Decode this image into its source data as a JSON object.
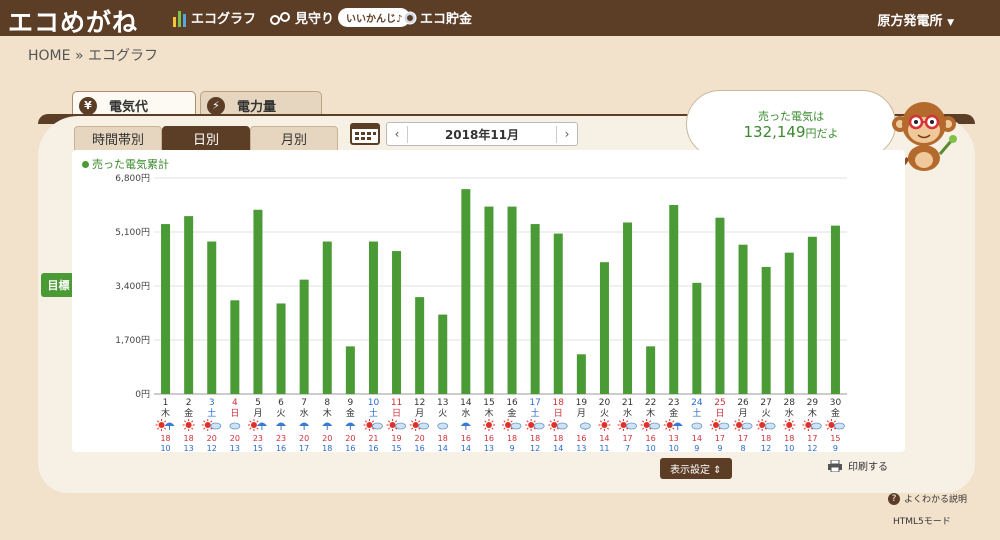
{
  "header": {
    "logo": "エコめがね",
    "nav": [
      {
        "label": "エコグラフ",
        "icon": "bar-graph-icon"
      },
      {
        "label": "見守り",
        "icon": "glasses-icon",
        "pill": "いいかんじ♪"
      },
      {
        "label": "エコ貯金",
        "icon": "coin-icon"
      }
    ],
    "plant": "原方発電所",
    "plant_arrow": "▼"
  },
  "breadcrumb": {
    "home": "HOME",
    "sep": "»",
    "current": "エコグラフ"
  },
  "outer_tabs": [
    {
      "label": "電気代",
      "icon": "yen-icon",
      "glyph": "¥",
      "active": true
    },
    {
      "label": "電力量",
      "icon": "lightning-icon",
      "glyph": "⚡",
      "active": false
    }
  ],
  "sub_tabs": [
    "時間帯別",
    "日別",
    "月別"
  ],
  "active_sub_tab": "日別",
  "date": {
    "label": "2018年11月",
    "prev": "‹",
    "next": "›"
  },
  "bubble": {
    "line1": "売った電気は",
    "amount": "132,149",
    "suffix": "円だよ"
  },
  "goal_button": "目標 ⇕",
  "display_settings": "表示設定 ⇕",
  "print": "印刷する",
  "help": "よくわかる説明",
  "html5": "HTML5モード",
  "colors": {
    "bar": "#4a9a35",
    "header": "#5c3d26",
    "saturday": "#2a6ad0",
    "sunday": "#d0303a",
    "accent": "#3a8a2c"
  },
  "chart_data": {
    "type": "bar",
    "legend": "売った電気累計",
    "y_ticks": [
      "0円",
      "1,700円",
      "3,400円",
      "5,100円",
      "6,800円"
    ],
    "ylim": [
      0,
      6800
    ],
    "days": [
      "1",
      "2",
      "3",
      "4",
      "5",
      "6",
      "7",
      "8",
      "9",
      "10",
      "11",
      "12",
      "13",
      "14",
      "15",
      "16",
      "17",
      "18",
      "19",
      "20",
      "21",
      "22",
      "23",
      "24",
      "25",
      "26",
      "27",
      "28",
      "29",
      "30"
    ],
    "weekdays": [
      "木",
      "金",
      "土",
      "日",
      "月",
      "火",
      "水",
      "木",
      "金",
      "土",
      "日",
      "月",
      "火",
      "水",
      "木",
      "金",
      "土",
      "日",
      "月",
      "火",
      "水",
      "木",
      "金",
      "土",
      "日",
      "月",
      "火",
      "水",
      "木",
      "金"
    ],
    "values": [
      5350,
      5600,
      4800,
      2950,
      5800,
      2850,
      3600,
      4800,
      1500,
      4800,
      4500,
      3050,
      2500,
      6450,
      5900,
      5900,
      5350,
      5050,
      1250,
      4150,
      5400,
      1500,
      5950,
      3500,
      5550,
      4700,
      4000,
      4450,
      4950,
      5300
    ],
    "weather": [
      "sun-umbrella",
      "sun",
      "sun-cloud",
      "cloud",
      "sun-umbrella",
      "umbrella",
      "umbrella",
      "umbrella",
      "umbrella",
      "sun-cloud",
      "sun-cloud",
      "sun-cloud",
      "cloud",
      "umbrella",
      "sun",
      "sun-cloud",
      "sun-cloud",
      "sun-cloud",
      "cloud-umbrella",
      "sun",
      "sun-cloud",
      "sun-cloud",
      "sun-umbrella",
      "cloud",
      "sun-cloud",
      "sun-cloud",
      "sun-cloud",
      "sun",
      "sun-cloud",
      "sun-cloud"
    ],
    "high_temps": [
      "18",
      "18",
      "20",
      "20",
      "23",
      "23",
      "20",
      "20",
      "20",
      "21",
      "19",
      "20",
      "18",
      "16",
      "16",
      "18",
      "18",
      "18",
      "16",
      "14",
      "17",
      "16",
      "13",
      "14",
      "17",
      "17",
      "18",
      "18",
      "17",
      "15"
    ],
    "low_temps": [
      "10",
      "13",
      "12",
      "13",
      "15",
      "16",
      "17",
      "18",
      "16",
      "16",
      "15",
      "16",
      "14",
      "14",
      "13",
      "9",
      "12",
      "14",
      "13",
      "11",
      "7",
      "10",
      "10",
      "9",
      "9",
      "8",
      "12",
      "10",
      "12",
      "9"
    ]
  }
}
